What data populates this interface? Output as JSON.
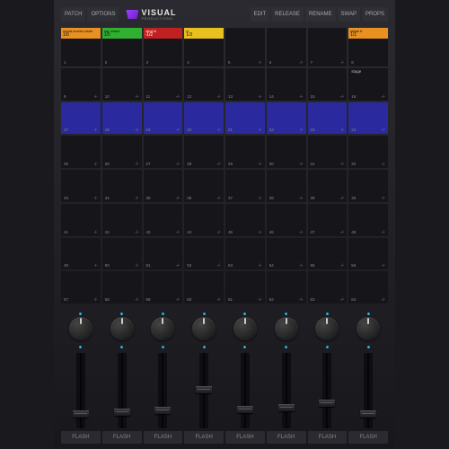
{
  "header": {
    "left": [
      "PATCH",
      "OPTIONS"
    ],
    "right": [
      "EDIT",
      "RELEASE",
      "RENAME",
      "SWAP",
      "PROPS"
    ],
    "brand_name": "VISUAL",
    "brand_sub": "PRODUCTIONS"
  },
  "empty_val": "-/-",
  "grid": {
    "rows": 8,
    "cols": 8,
    "highlight_row": 2,
    "cells": [
      {
        "r": 0,
        "c": 0,
        "name": "mega moves circle",
        "val": "1/6",
        "color": "orange"
      },
      {
        "r": 0,
        "c": 1,
        "name": "par chase",
        "val": "1/5",
        "color": "green"
      },
      {
        "r": 0,
        "c": 2,
        "name": "blind fx",
        "val": "-1/2",
        "color": "red"
      },
      {
        "r": 0,
        "c": 3,
        "name": "cl",
        "val": "1/3",
        "color": "yellow"
      },
      {
        "r": 0,
        "c": 7,
        "name": "stage fr",
        "val": "1/1",
        "color": "orange"
      },
      {
        "r": 1,
        "c": 7,
        "name": "stage",
        "val": "",
        "color": ""
      }
    ]
  },
  "mixer": {
    "channels": 8,
    "flash_label": "FLASH",
    "fader_positions": [
      0.95,
      0.92,
      0.9,
      0.55,
      0.88,
      0.85,
      0.78,
      0.95
    ]
  }
}
